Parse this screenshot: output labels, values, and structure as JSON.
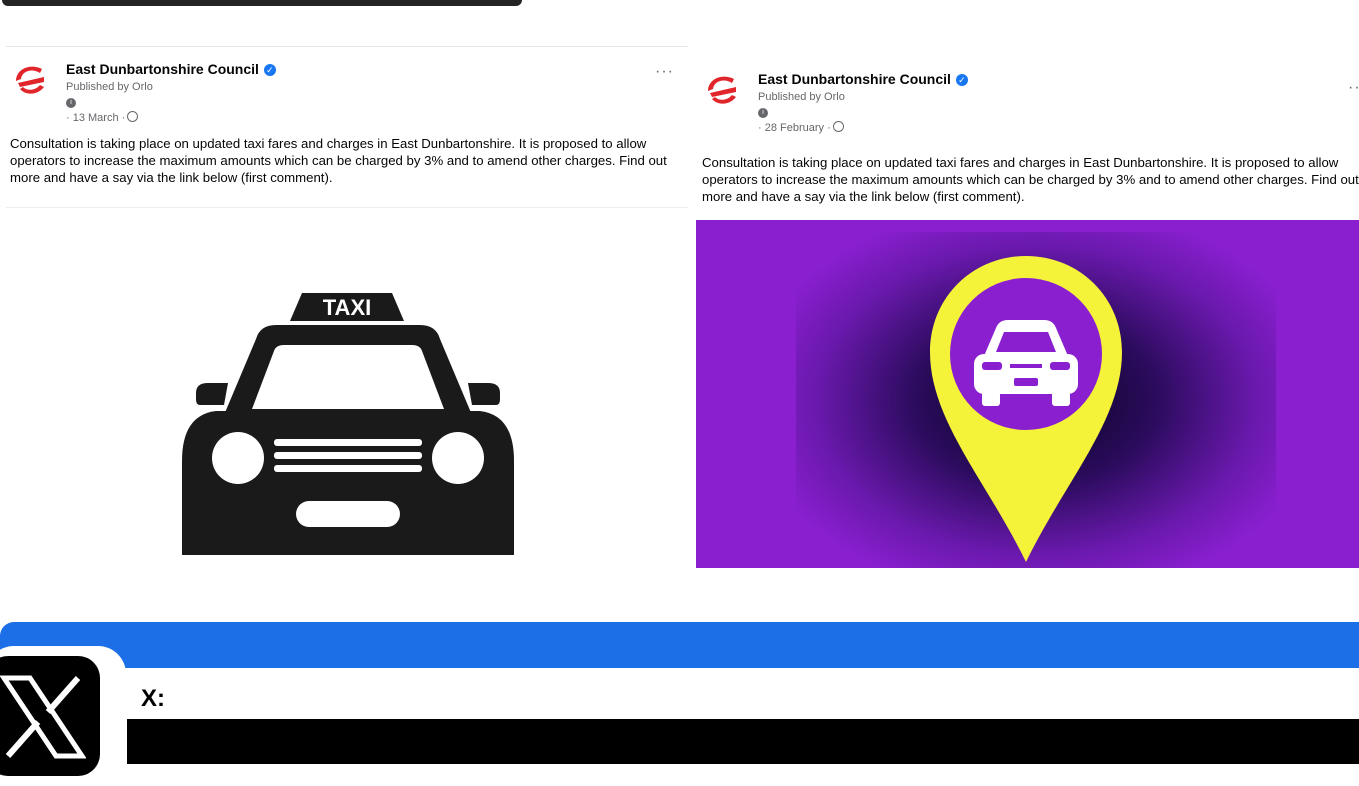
{
  "posts": [
    {
      "page_name": "East Dunbartonshire Council",
      "published_by": "Published by Orlo",
      "date": "· 13 March ·",
      "more": "···",
      "text": "Consultation is taking place on updated taxi fares and charges in East Dunbartonshire. It is proposed to allow operators to increase the maximum amounts which can be charged by 3% and to amend other charges. Find out more and have a say via the link below (first comment).",
      "image_text": "TAXI"
    },
    {
      "page_name": "East Dunbartonshire Council",
      "published_by": "Published by Orlo",
      "date": "· 28 February ·",
      "more": "···",
      "text": "Consultation is taking place on updated taxi fares and charges in East Dunbartonshire. It is proposed to allow operators to increase the maximum amounts which can be charged by 3% and to amend other charges. Find out more and have a say via the link below (first comment)."
    }
  ],
  "section": {
    "label": "X:"
  },
  "colors": {
    "banner": "#1d6fe8",
    "verified": "#1877f2",
    "pin_yellow": "#f5f23a",
    "pin_purple": "#8a1fd0",
    "logo_red": "#e0262b"
  }
}
